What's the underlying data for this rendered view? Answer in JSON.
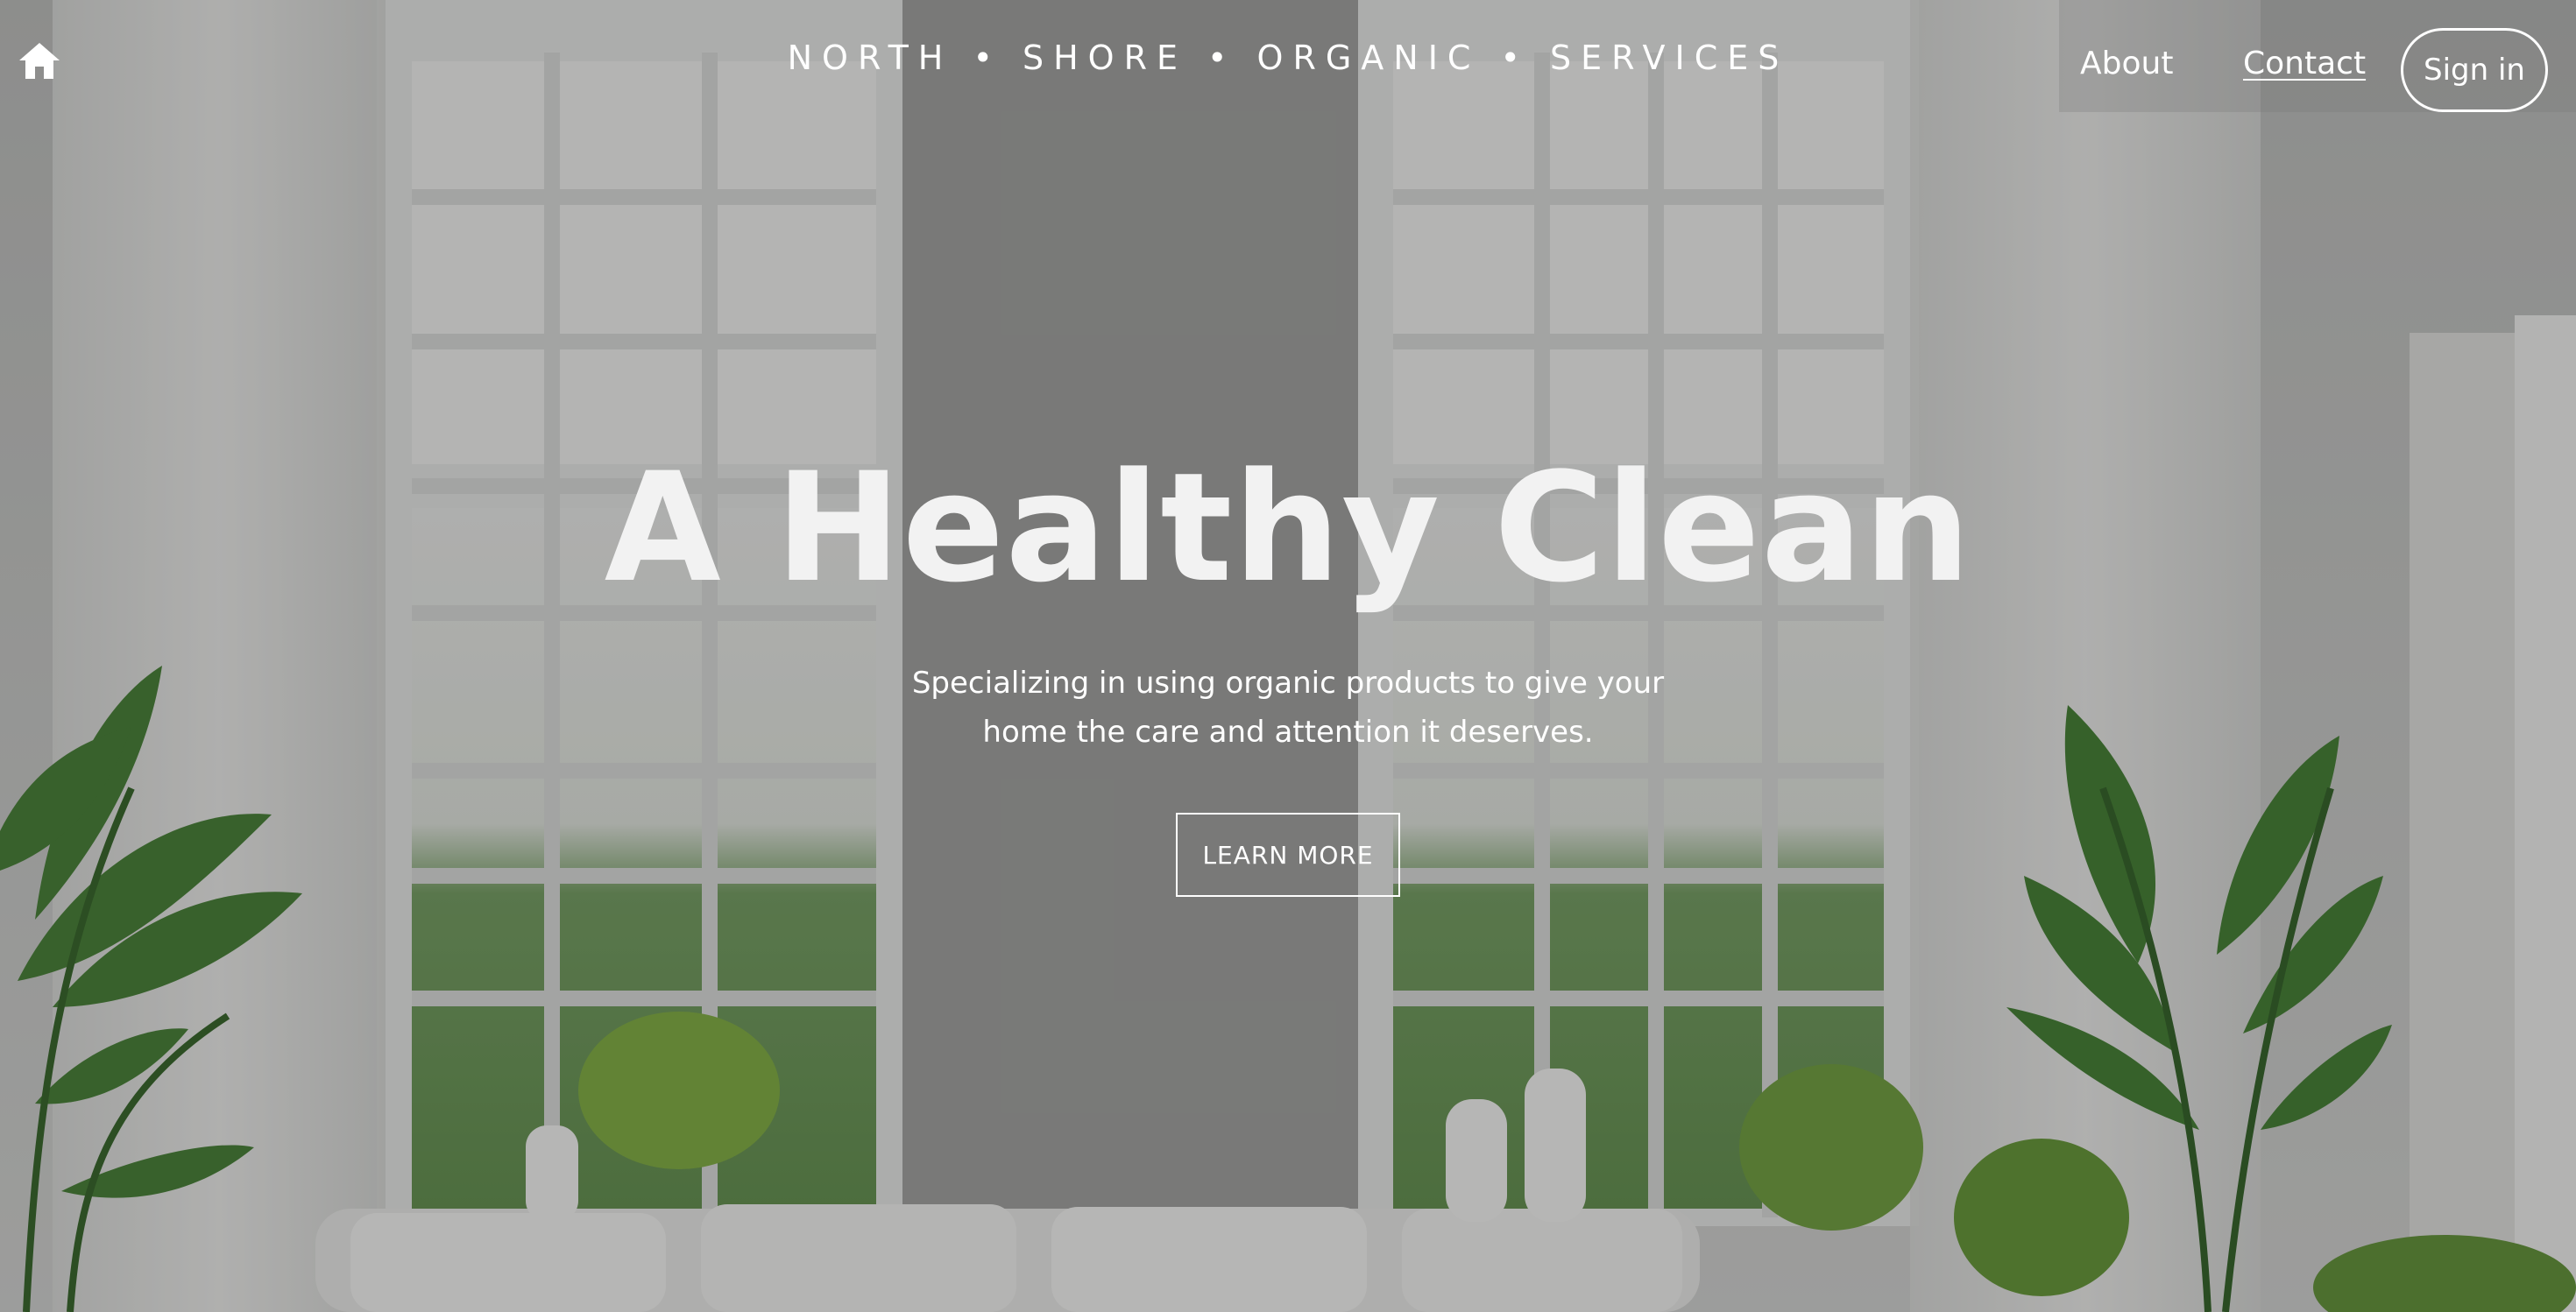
{
  "header": {
    "home_icon": "home-icon",
    "brand": "NORTH • SHORE • ORGANIC • SERVICES",
    "nav": {
      "about_label": "About",
      "contact_label": "Contact",
      "signin_label": "Sign in"
    }
  },
  "hero": {
    "title": "A Healthy Clean",
    "subtitle_line1": "Specializing in using organic products to give your",
    "subtitle_line2": "home the care and attention it deserves.",
    "cta_label": "LEARN MORE"
  },
  "colors": {
    "text": "#ffffff",
    "overlay": "#282828",
    "foliage": "#3f7a2e"
  }
}
